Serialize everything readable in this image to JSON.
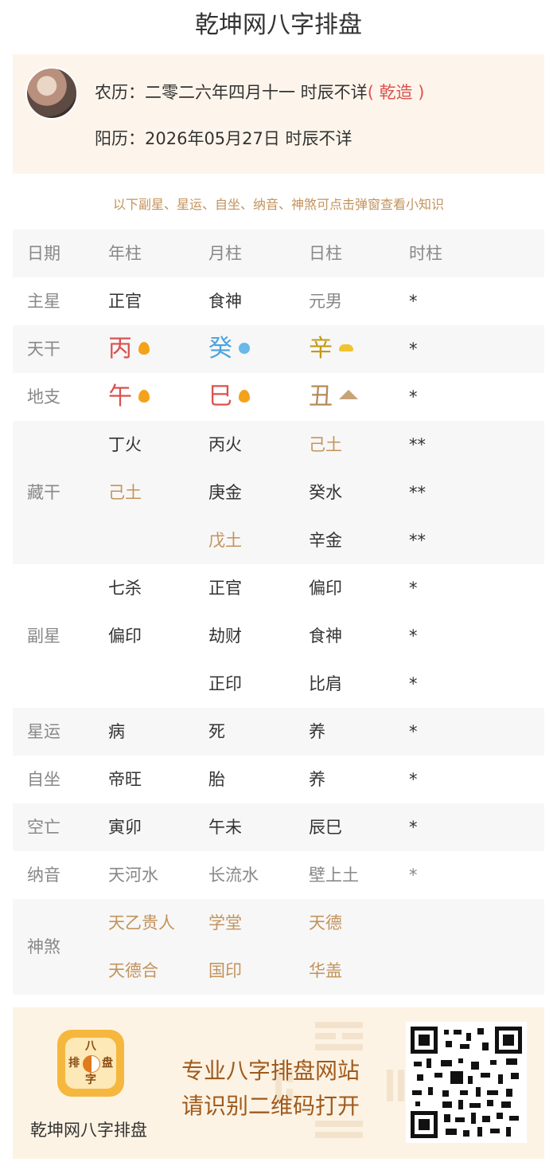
{
  "page": {
    "title": "乾坤网八字排盘"
  },
  "profile": {
    "lunar": "农历：二零二六年四月十一 时辰不详",
    "gender_tag": "( 乾造 )",
    "solar": "阳历：2026年05月27日 时辰不详"
  },
  "tip": "以下副星、星运、自坐、纳音、神煞可点击弹窗查看小知识",
  "table": {
    "header": {
      "label": "日期",
      "year": "年柱",
      "month": "月柱",
      "day": "日柱",
      "hour": "时柱"
    },
    "zhuxing": {
      "label": "主星",
      "year": "正官",
      "month": "食神",
      "day": "元男",
      "hour": "*"
    },
    "tiangan": {
      "label": "天干",
      "year": "丙",
      "month": "癸",
      "day": "辛",
      "hour": "*",
      "year_icon": "flame-icon",
      "month_icon": "water-drop-icon",
      "day_icon": "gold-ingot-icon"
    },
    "dizhi": {
      "label": "地支",
      "year": "午",
      "month": "巳",
      "day": "丑",
      "hour": "*",
      "year_icon": "flame-icon",
      "month_icon": "flame-icon",
      "day_icon": "mountain-icon"
    },
    "canggan": {
      "label": "藏干",
      "year": [
        "丁火",
        "己土"
      ],
      "month": [
        "丙火",
        "庚金",
        "戊土"
      ],
      "day": [
        "己土",
        "癸水",
        "辛金"
      ],
      "hour": [
        "**",
        "**",
        "**"
      ]
    },
    "fuxing": {
      "label": "副星",
      "year": [
        "七杀",
        "偏印"
      ],
      "month": [
        "正官",
        "劫财",
        "正印"
      ],
      "day": [
        "偏印",
        "食神",
        "比肩"
      ],
      "hour": [
        "*",
        "*",
        "*"
      ]
    },
    "xingyun": {
      "label": "星运",
      "year": "病",
      "month": "死",
      "day": "养",
      "hour": "*"
    },
    "zizuo": {
      "label": "自坐",
      "year": "帝旺",
      "month": "胎",
      "day": "养",
      "hour": "*"
    },
    "kongwang": {
      "label": "空亡",
      "year": "寅卯",
      "month": "午未",
      "day": "辰巳",
      "hour": "*"
    },
    "nayin": {
      "label": "纳音",
      "year": "天河水",
      "month": "长流水",
      "day": "壁上土",
      "hour": "*"
    },
    "shensha": {
      "label": "神煞",
      "year": [
        "天乙贵人",
        "天德合"
      ],
      "month": [
        "学堂",
        "国印"
      ],
      "day": [
        "天德",
        "华盖"
      ]
    }
  },
  "banner": {
    "app_name": "乾坤网八字排盘",
    "logo_chars": [
      "八",
      "排",
      "盘",
      "字"
    ],
    "slogan_1": "专业八字排盘网站",
    "slogan_2": "请识别二维码打开"
  },
  "colors": {
    "accent_gold": "#c3935b",
    "fire_red": "#d9534f",
    "water_blue": "#4aa3df",
    "metal_yellow": "#c49a16",
    "earth_tan": "#b58b5b"
  }
}
